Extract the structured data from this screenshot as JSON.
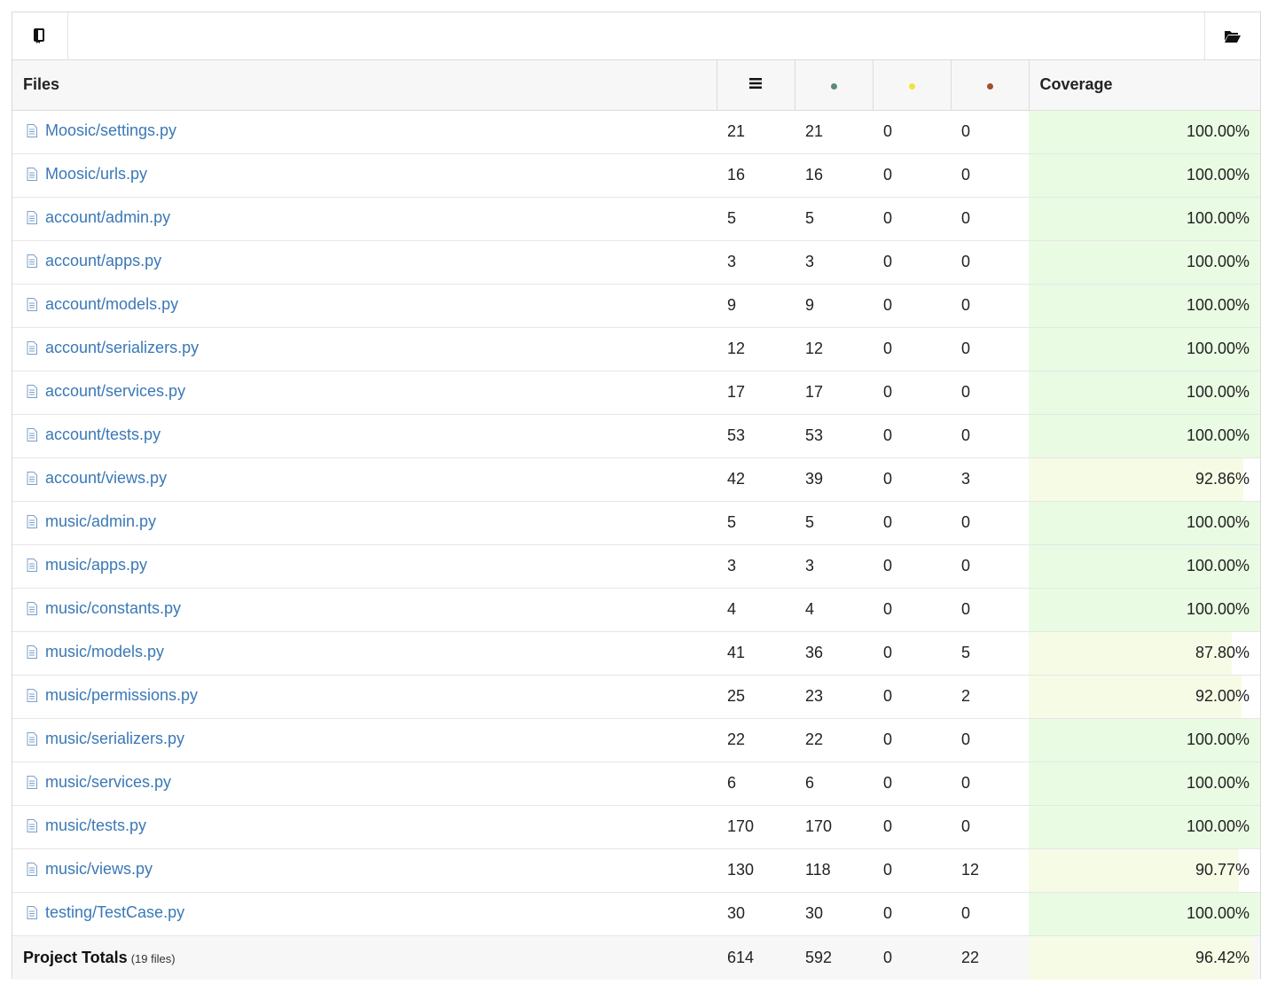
{
  "toolbar": {
    "left_icon": "book-icon",
    "right_icon": "folder-open-icon"
  },
  "colors": {
    "link": "#3a78b6",
    "covered_dot": "#5a8a80",
    "partial_dot": "#f3e33b",
    "missed_dot": "#a0522d",
    "full_coverage_bg": "#e9fbe3",
    "partial_coverage_bg": "#f6fbe6"
  },
  "header": {
    "files": "Files",
    "lines_icon": "list-icon",
    "covered_icon": "covered-dot-icon",
    "partial_icon": "partial-dot-icon",
    "missed_icon": "missed-dot-icon",
    "coverage": "Coverage"
  },
  "rows": [
    {
      "file": "Moosic/settings.py",
      "lines": "21",
      "covered": "21",
      "partial": "0",
      "missed": "0",
      "coverage": "100.00%",
      "pct": 100
    },
    {
      "file": "Moosic/urls.py",
      "lines": "16",
      "covered": "16",
      "partial": "0",
      "missed": "0",
      "coverage": "100.00%",
      "pct": 100
    },
    {
      "file": "account/admin.py",
      "lines": "5",
      "covered": "5",
      "partial": "0",
      "missed": "0",
      "coverage": "100.00%",
      "pct": 100
    },
    {
      "file": "account/apps.py",
      "lines": "3",
      "covered": "3",
      "partial": "0",
      "missed": "0",
      "coverage": "100.00%",
      "pct": 100
    },
    {
      "file": "account/models.py",
      "lines": "9",
      "covered": "9",
      "partial": "0",
      "missed": "0",
      "coverage": "100.00%",
      "pct": 100
    },
    {
      "file": "account/serializers.py",
      "lines": "12",
      "covered": "12",
      "partial": "0",
      "missed": "0",
      "coverage": "100.00%",
      "pct": 100
    },
    {
      "file": "account/services.py",
      "lines": "17",
      "covered": "17",
      "partial": "0",
      "missed": "0",
      "coverage": "100.00%",
      "pct": 100
    },
    {
      "file": "account/tests.py",
      "lines": "53",
      "covered": "53",
      "partial": "0",
      "missed": "0",
      "coverage": "100.00%",
      "pct": 100
    },
    {
      "file": "account/views.py",
      "lines": "42",
      "covered": "39",
      "partial": "0",
      "missed": "3",
      "coverage": "92.86%",
      "pct": 92.86
    },
    {
      "file": "music/admin.py",
      "lines": "5",
      "covered": "5",
      "partial": "0",
      "missed": "0",
      "coverage": "100.00%",
      "pct": 100
    },
    {
      "file": "music/apps.py",
      "lines": "3",
      "covered": "3",
      "partial": "0",
      "missed": "0",
      "coverage": "100.00%",
      "pct": 100
    },
    {
      "file": "music/constants.py",
      "lines": "4",
      "covered": "4",
      "partial": "0",
      "missed": "0",
      "coverage": "100.00%",
      "pct": 100
    },
    {
      "file": "music/models.py",
      "lines": "41",
      "covered": "36",
      "partial": "0",
      "missed": "5",
      "coverage": "87.80%",
      "pct": 87.8
    },
    {
      "file": "music/permissions.py",
      "lines": "25",
      "covered": "23",
      "partial": "0",
      "missed": "2",
      "coverage": "92.00%",
      "pct": 92
    },
    {
      "file": "music/serializers.py",
      "lines": "22",
      "covered": "22",
      "partial": "0",
      "missed": "0",
      "coverage": "100.00%",
      "pct": 100
    },
    {
      "file": "music/services.py",
      "lines": "6",
      "covered": "6",
      "partial": "0",
      "missed": "0",
      "coverage": "100.00%",
      "pct": 100
    },
    {
      "file": "music/tests.py",
      "lines": "170",
      "covered": "170",
      "partial": "0",
      "missed": "0",
      "coverage": "100.00%",
      "pct": 100
    },
    {
      "file": "music/views.py",
      "lines": "130",
      "covered": "118",
      "partial": "0",
      "missed": "12",
      "coverage": "90.77%",
      "pct": 90.77
    },
    {
      "file": "testing/TestCase.py",
      "lines": "30",
      "covered": "30",
      "partial": "0",
      "missed": "0",
      "coverage": "100.00%",
      "pct": 100
    }
  ],
  "totals": {
    "label": "Project Totals",
    "files_note": "(19 files)",
    "lines": "614",
    "covered": "592",
    "partial": "0",
    "missed": "22",
    "coverage": "96.42%",
    "pct": 96.42
  }
}
